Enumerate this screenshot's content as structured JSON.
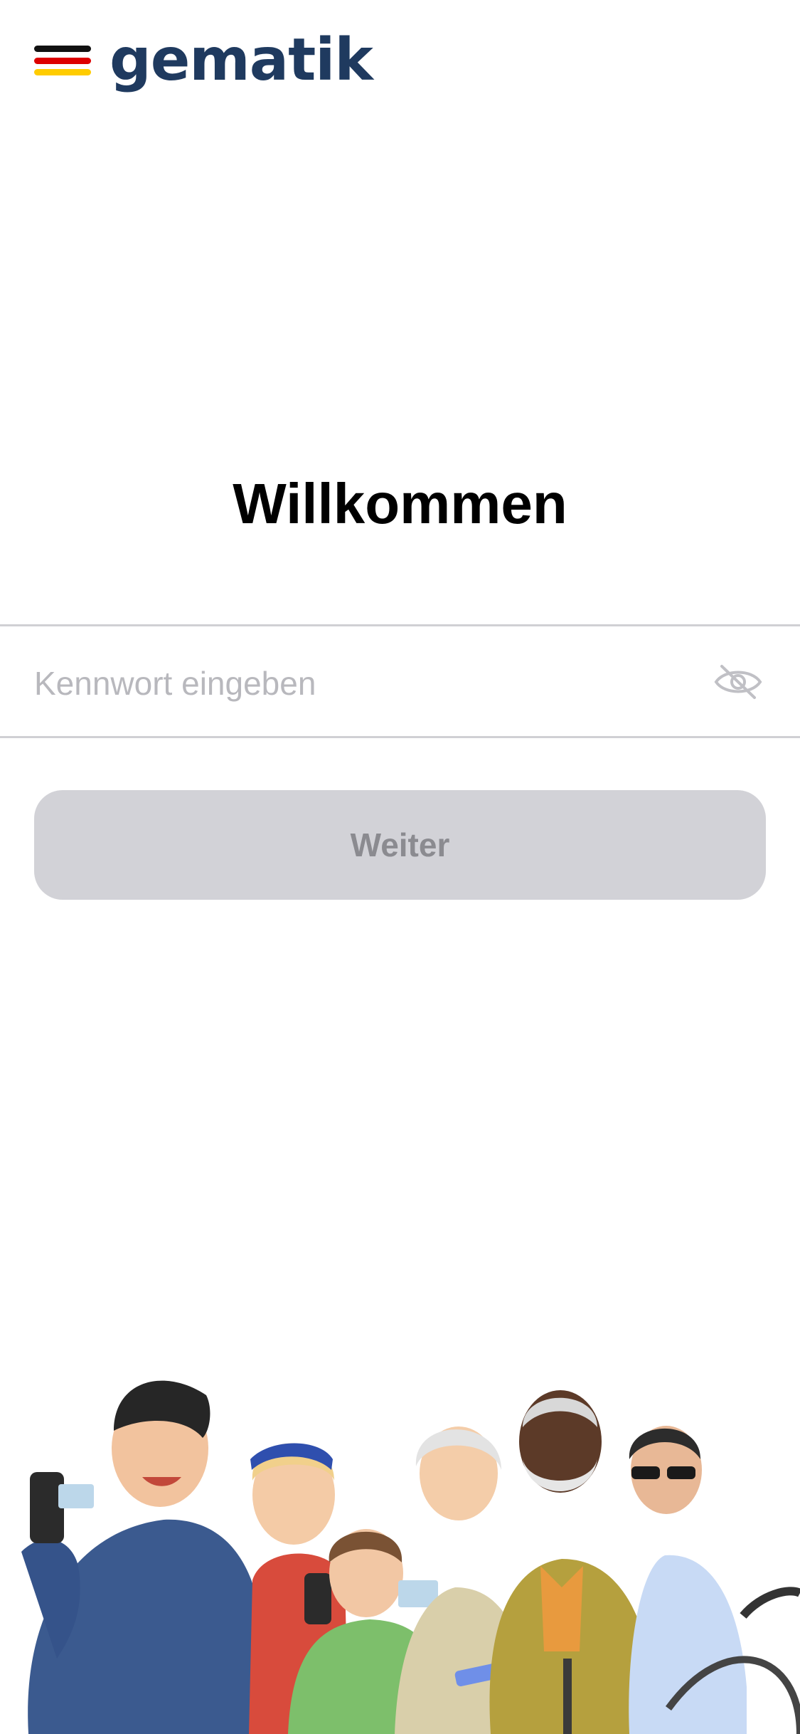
{
  "header": {
    "logo_text": "gematik",
    "logo_stripe_colors": [
      "#111111",
      "#dd0000",
      "#ffcc00"
    ]
  },
  "main": {
    "title": "Willkommen",
    "password_field": {
      "placeholder": "Kennwort eingeben",
      "value": "",
      "visibility_icon": "eye-slash-icon"
    },
    "continue_button": {
      "label": "Weiter",
      "enabled": false
    }
  },
  "illustration": {
    "name": "people-group-illustration"
  },
  "colors": {
    "brand_text": "#1f3a5f",
    "button_disabled_bg": "#d2d2d7",
    "button_disabled_text": "#8b8b90",
    "divider": "#d0d0d4",
    "placeholder": "#b8b8bd"
  }
}
